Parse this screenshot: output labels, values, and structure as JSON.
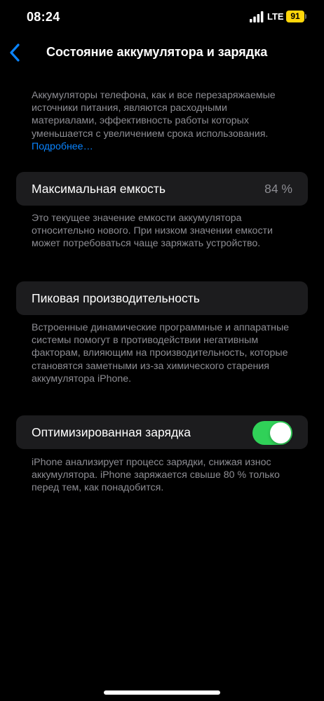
{
  "status_bar": {
    "time": "08:24",
    "network": "LTE",
    "battery": "91",
    "icons": [
      "signal-icon",
      "battery-icon"
    ],
    "battery_color": "#ffd60a"
  },
  "nav": {
    "back_icon": "chevron-left-icon",
    "title": "Состояние аккумулятора и зарядка"
  },
  "intro": {
    "text": "Аккумуляторы телефона, как и все перезаряжаемые источники питания, являются расходными материалами, эффективность работы которых уменьшается с увеличением срока использования.",
    "link": "Подробнее…"
  },
  "max_capacity": {
    "label": "Максимальная емкость",
    "value": "84 %",
    "footnote": "Это текущее значение емкости аккумулятора относительно нового. При низком значении емкости может потребоваться чаще заряжать устройство."
  },
  "peak_performance": {
    "label": "Пиковая производительность",
    "footnote": "Встроенные динамические программные и аппаратные системы помогут в противодействии негативным факторам, влияющим на производительность, которые становятся заметными из-за химического старения аккумулятора iPhone."
  },
  "optimized_charging": {
    "label": "Оптимизированная зарядка",
    "enabled": true,
    "toggle_color": "#30d158",
    "footnote": "iPhone анализирует процесс зарядки, снижая износ аккумулятора. iPhone заряжается свыше 80 % только перед тем, как понадобится."
  },
  "colors": {
    "background": "#000000",
    "card": "#1c1c1e",
    "secondary_text": "#8d8d93",
    "link": "#0a84ff"
  }
}
